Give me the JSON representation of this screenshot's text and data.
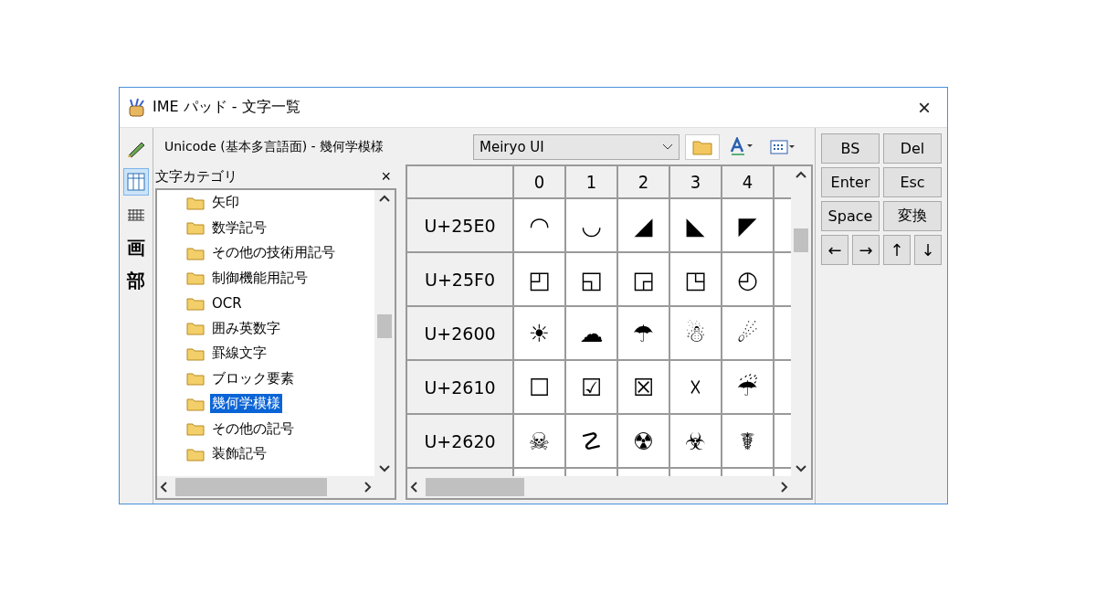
{
  "window": {
    "title": "IME パッド - 文字一覧",
    "close": "×"
  },
  "tool_strip": [
    {
      "kind": "handwriting",
      "selected": false
    },
    {
      "kind": "char-list",
      "selected": true
    },
    {
      "kind": "soft-keyboard",
      "selected": false
    },
    {
      "kind": "glyph",
      "label": "画",
      "selected": false
    },
    {
      "kind": "glyph",
      "label": "部",
      "selected": false
    }
  ],
  "toolbar": {
    "range_label": "Unicode (基本多言語面) - 幾何学模様",
    "font_select": {
      "value": "Meiryo UI"
    }
  },
  "category_panel": {
    "title": "文字カテゴリ",
    "close": "×",
    "items": [
      {
        "label": "矢印",
        "selected": false
      },
      {
        "label": "数学記号",
        "selected": false
      },
      {
        "label": "その他の技術用記号",
        "selected": false
      },
      {
        "label": "制御機能用記号",
        "selected": false
      },
      {
        "label": "OCR",
        "selected": false
      },
      {
        "label": "囲み英数字",
        "selected": false
      },
      {
        "label": "罫線文字",
        "selected": false
      },
      {
        "label": "ブロック要素",
        "selected": false
      },
      {
        "label": "幾何学模様",
        "selected": true
      },
      {
        "label": "その他の記号",
        "selected": false
      },
      {
        "label": "装飾記号",
        "selected": false
      }
    ]
  },
  "char_grid": {
    "columns": [
      "0",
      "1",
      "2",
      "3",
      "4"
    ],
    "rows": [
      {
        "code": "U+25E0",
        "chars": [
          "◠",
          "◡",
          "◢",
          "◣",
          "◤"
        ]
      },
      {
        "code": "U+25F0",
        "chars": [
          "◰",
          "◱",
          "◲",
          "◳",
          "◴"
        ]
      },
      {
        "code": "U+2600",
        "chars": [
          "☀",
          "☁",
          "☂",
          "☃",
          "☄"
        ]
      },
      {
        "code": "U+2610",
        "chars": [
          "☐",
          "☑",
          "☒",
          "☓",
          "☔"
        ]
      },
      {
        "code": "U+2620",
        "chars": [
          "☠",
          "☡",
          "☢",
          "☣",
          "☤"
        ]
      }
    ]
  },
  "keys": [
    "BS",
    "Del",
    "Enter",
    "Esc",
    "Space",
    "変換"
  ],
  "arrow_keys": [
    "←",
    "→",
    "↑",
    "↓"
  ]
}
